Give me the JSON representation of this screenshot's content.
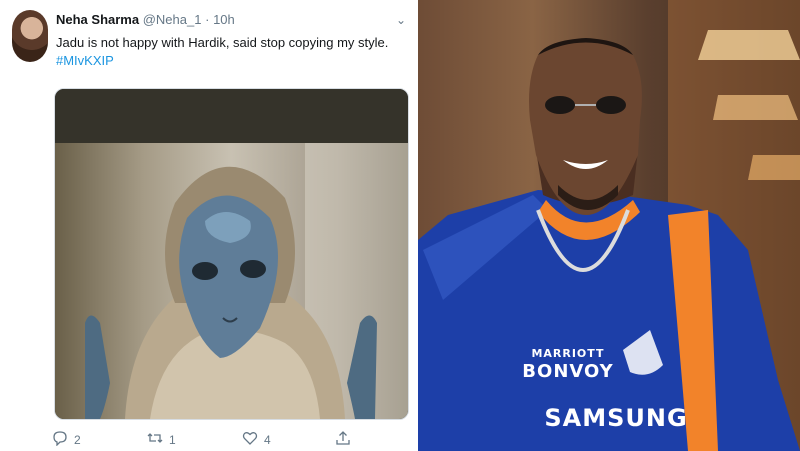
{
  "tweet": {
    "display_name": "Neha Sharma",
    "handle": "@Neha_1",
    "separator": "·",
    "time": "10h",
    "text": "Jadu is not happy with Hardik, said stop copying my style.",
    "hashtag": "#MIvKXIP",
    "media_icon": "alien-character-image",
    "actions": {
      "reply_count": "2",
      "retweet_count": "1",
      "like_count": "4"
    }
  },
  "photo": {
    "jersey_text_top": "MARRIOTT",
    "jersey_text_main": "BONVOY",
    "jersey_text_bottom": "SAMSUNG"
  },
  "colors": {
    "link": "#1b95e0",
    "muted": "#657786",
    "jersey_blue": "#1d3fa8",
    "jersey_orange": "#f2832a"
  }
}
